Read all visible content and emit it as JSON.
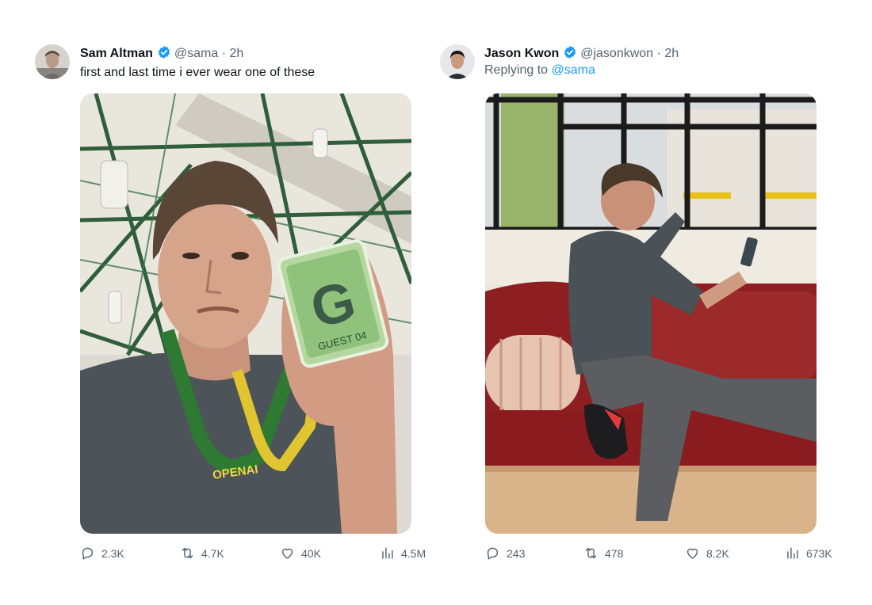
{
  "tweets": [
    {
      "author_name": "Sam Altman",
      "handle": "@sama",
      "separator": "·",
      "time": "2h",
      "text": "first and last time i ever wear one of these",
      "media": {
        "badge_letter": "G",
        "badge_text": "GUEST 04",
        "lanyard_text": "OPENAI"
      },
      "stats": {
        "replies": "2.3K",
        "reposts": "4.7K",
        "likes": "40K",
        "views": "4.5M"
      }
    },
    {
      "author_name": "Jason Kwon",
      "handle": "@jasonkwon",
      "separator": "·",
      "time": "2h",
      "replying_prefix": "Replying to",
      "replying_to": "@sama",
      "stats": {
        "replies": "243",
        "reposts": "478",
        "likes": "8.2K",
        "views": "673K"
      }
    }
  ],
  "icons": {
    "verified": "verified-badge-icon",
    "reply": "reply-icon",
    "repost": "repost-icon",
    "like": "heart-icon",
    "views": "views-icon"
  },
  "colors": {
    "verified": "#1d9bf0",
    "mention": "#1d9bf0",
    "secondary_text": "#536471",
    "primary_text": "#0f1419"
  }
}
